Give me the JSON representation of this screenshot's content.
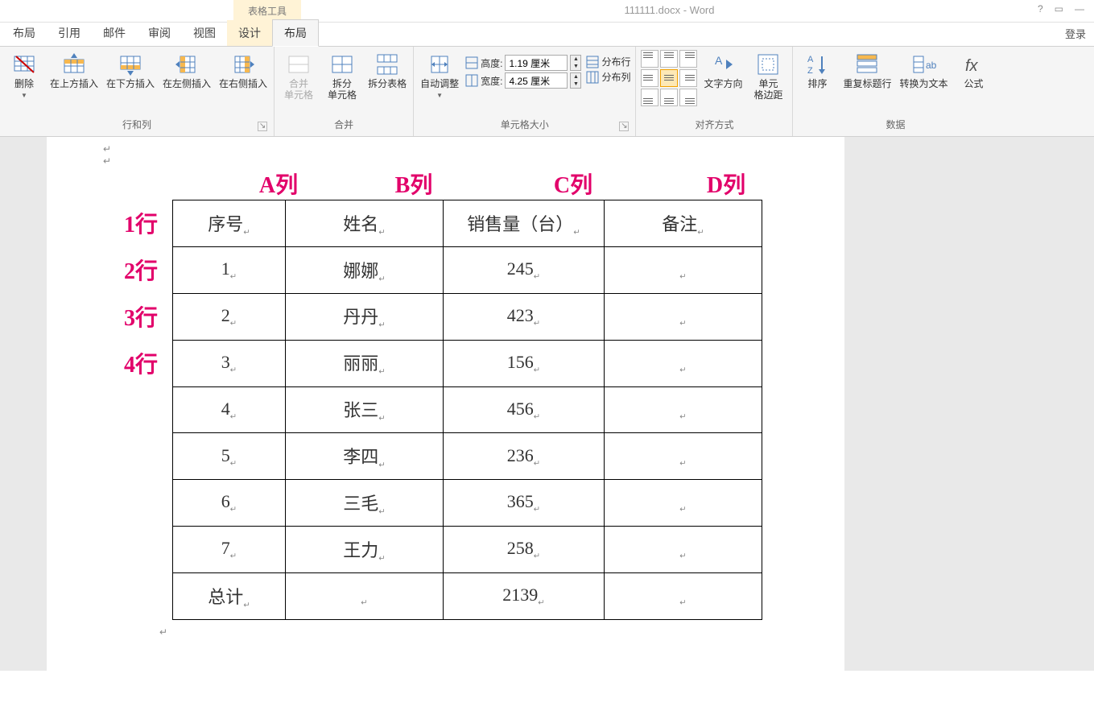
{
  "app": {
    "table_tools_label": "表格工具",
    "doc_title": "111111.docx - Word",
    "help": "?",
    "maximize": "▭",
    "minimize": "—",
    "login": "登录"
  },
  "tabs": {
    "layout": "布局",
    "reference": "引用",
    "mail": "邮件",
    "review": "审阅",
    "view": "视图",
    "tt_design": "设计",
    "tt_layout": "布局"
  },
  "ribbon": {
    "delete": "删除",
    "ins_above": "在上方插入",
    "ins_below": "在下方插入",
    "ins_left": "在左侧插入",
    "ins_right": "在右侧插入",
    "group_rows_cols": "行和列",
    "merge": "合并\n单元格",
    "split_cells": "拆分\n单元格",
    "split_table": "拆分表格",
    "group_merge": "合并",
    "autofit": "自动调整",
    "height_lbl": "高度:",
    "height_val": "1.19 厘米",
    "width_lbl": "宽度:",
    "width_val": "4.25 厘米",
    "dist_rows": "分布行",
    "dist_cols": "分布列",
    "group_cellsize": "单元格大小",
    "text_dir": "文字方向",
    "cell_margin": "单元\n格边距",
    "group_align": "对齐方式",
    "sort": "排序",
    "repeat_header": "重复标题行",
    "to_text": "转换为文本",
    "formula": "公式",
    "group_data": "数据"
  },
  "doc": {
    "col_labels": [
      "A列",
      "B列",
      "C列",
      "D列"
    ],
    "row_labels": [
      "1行",
      "2行",
      "3行",
      "4行"
    ],
    "headers": [
      "序号",
      "姓名",
      "销售量（台）",
      "备注"
    ],
    "rows": [
      [
        "1",
        "娜娜",
        "245",
        ""
      ],
      [
        "2",
        "丹丹",
        "423",
        ""
      ],
      [
        "3",
        "丽丽",
        "156",
        ""
      ],
      [
        "4",
        "张三",
        "456",
        ""
      ],
      [
        "5",
        "李四",
        "236",
        ""
      ],
      [
        "6",
        "三毛",
        "365",
        ""
      ],
      [
        "7",
        "王力",
        "258",
        ""
      ],
      [
        "总计",
        "",
        "2139",
        ""
      ]
    ]
  }
}
